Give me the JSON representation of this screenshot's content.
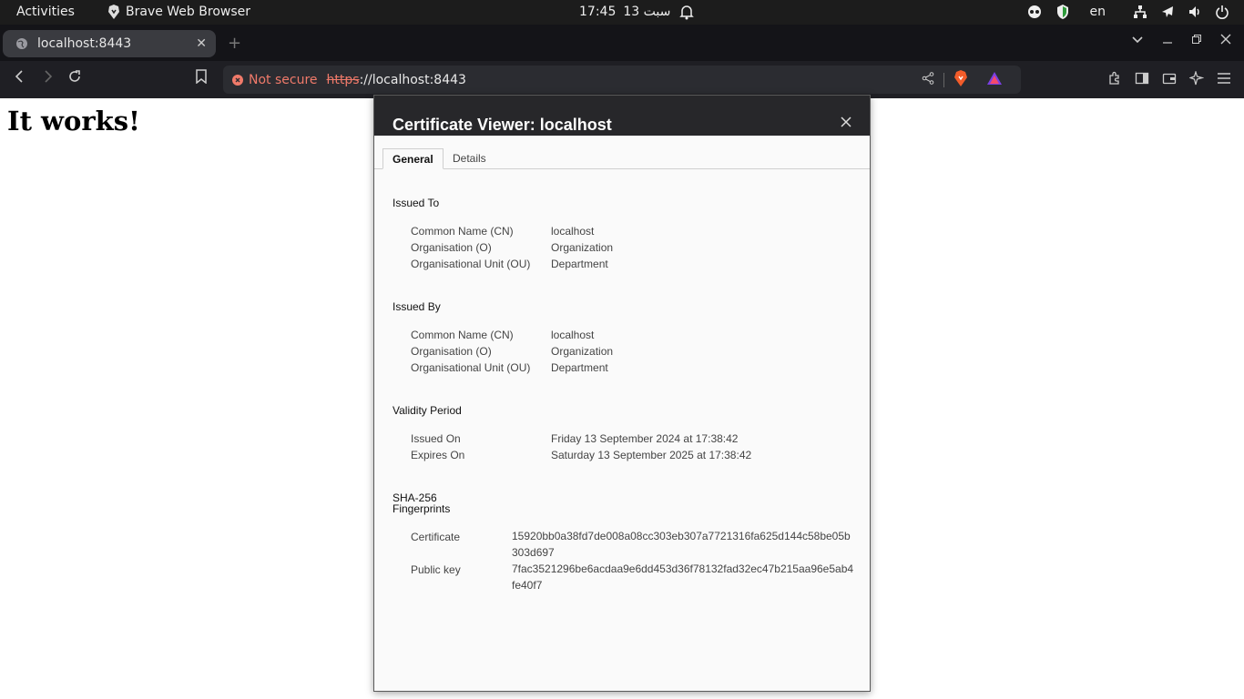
{
  "topbar": {
    "activities": "Activities",
    "app_name": "Brave Web Browser",
    "clock_time": "17:45",
    "clock_date": "13 سبت",
    "lang": "en"
  },
  "tab": {
    "title": "localhost:8443"
  },
  "urlbar": {
    "security": "Not secure",
    "scheme": "https",
    "rest": "://localhost:8443"
  },
  "page": {
    "heading": "It works!"
  },
  "dialog": {
    "title": "Certificate Viewer: localhost",
    "tabs": [
      "General",
      "Details"
    ],
    "issued_to": {
      "heading": "Issued To",
      "rows": [
        {
          "label": "Common Name (CN)",
          "value": "localhost"
        },
        {
          "label": "Organisation (O)",
          "value": "Organization"
        },
        {
          "label": "Organisational Unit (OU)",
          "value": "Department"
        }
      ]
    },
    "issued_by": {
      "heading": "Issued By",
      "rows": [
        {
          "label": "Common Name (CN)",
          "value": "localhost"
        },
        {
          "label": "Organisation (O)",
          "value": "Organization"
        },
        {
          "label": "Organisational Unit (OU)",
          "value": "Department"
        }
      ]
    },
    "validity": {
      "heading": "Validity Period",
      "rows": [
        {
          "label": "Issued On",
          "value": "Friday 13 September 2024 at 17:38:42"
        },
        {
          "label": "Expires On",
          "value": "Saturday 13 September 2025 at 17:38:42"
        }
      ]
    },
    "fingerprints": {
      "heading_1": "SHA-256",
      "heading_2": "Fingerprints",
      "rows": [
        {
          "label": "Certificate",
          "value": "15920bb0a38fd7de008a08cc303eb307a7721316fa625d144c58be05b303d697"
        },
        {
          "label": "Public key",
          "value": "7fac3521296be6acdaa9e6dd453d36f78132fad32ec47b215aa96e5ab4fe40f7"
        }
      ]
    }
  }
}
